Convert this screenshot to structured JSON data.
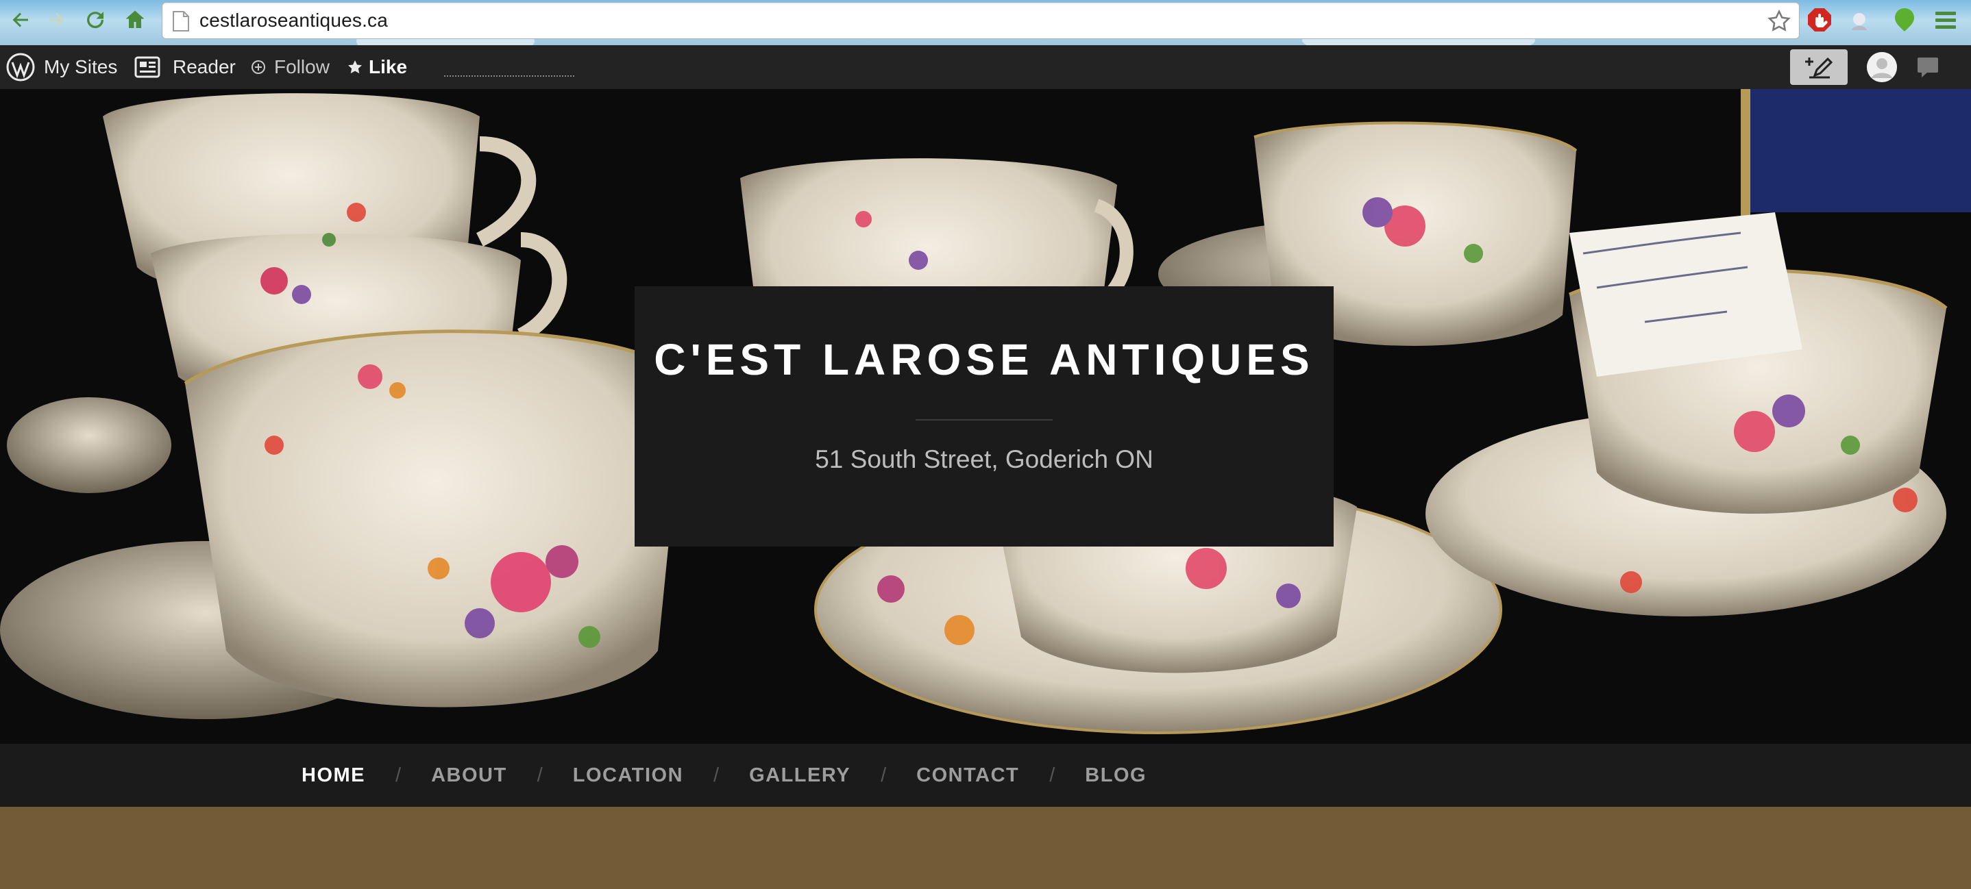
{
  "browser": {
    "url": "cestlaroseantiques.ca",
    "nav_icons": [
      "back-arrow-icon",
      "forward-arrow-icon",
      "reload-icon",
      "home-icon"
    ],
    "extension_icons": [
      "adblock-icon",
      "extension-icon",
      "evernote-icon",
      "menu-icon"
    ]
  },
  "admin_bar": {
    "my_sites": "My Sites",
    "reader": "Reader",
    "follow": "Follow",
    "like": "Like"
  },
  "header": {
    "site_title": "C'EST LAROSE ANTIQUES",
    "tagline": "51 South Street, Goderich ON"
  },
  "nav": {
    "items": [
      {
        "label": "HOME",
        "current": true
      },
      {
        "label": "ABOUT",
        "current": false
      },
      {
        "label": "LOCATION",
        "current": false
      },
      {
        "label": "GALLERY",
        "current": false
      },
      {
        "label": "CONTACT",
        "current": false
      },
      {
        "label": "BLOG",
        "current": false
      }
    ],
    "separator": "/"
  },
  "colors": {
    "admin_bar_bg": "#232323",
    "title_box_bg": "#1b1b1b",
    "nav_bg": "#1b1b1b",
    "content_bg": "#735b35"
  }
}
